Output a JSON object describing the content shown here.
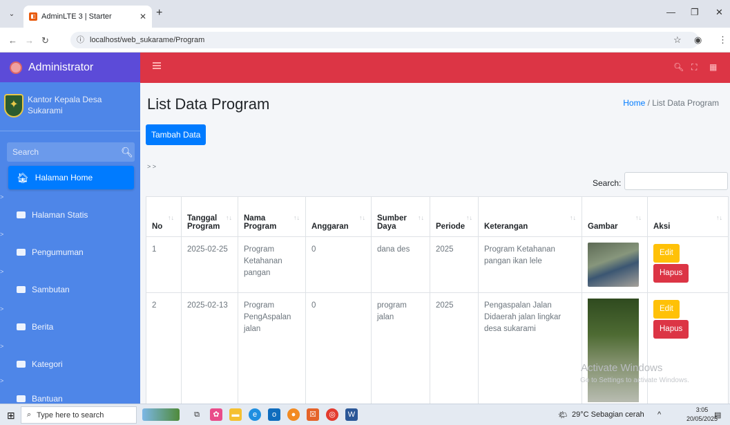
{
  "browser": {
    "tab_title": "AdminLTE 3 | Starter",
    "url": "localhost/web_sukarame/Program"
  },
  "sidebar": {
    "brand": "Administrator",
    "user_name": "Kantor Kepala Desa Sukarami",
    "search_placeholder": "Search",
    "items": [
      {
        "label": "Halaman Home"
      },
      {
        "label": "Halaman Statis"
      },
      {
        "label": "Pengumuman"
      },
      {
        "label": "Sambutan"
      },
      {
        "label": "Berita"
      },
      {
        "label": "Kategori"
      },
      {
        "label": "Bantuan"
      }
    ]
  },
  "page": {
    "title": "List Data Program",
    "breadcrumb_home": "Home",
    "breadcrumb_sep": "/",
    "breadcrumb_current": "List Data Program",
    "add_button": "Tambah Data",
    "nav_marks": "> >",
    "search_label": "Search:"
  },
  "table": {
    "headers": [
      "No",
      "Tanggal Program",
      "Nama Program",
      "Anggaran",
      "Sumber Daya",
      "Periode",
      "Keterangan",
      "Gambar",
      "Aksi"
    ],
    "rows": [
      {
        "no": "1",
        "tanggal": "2025-02-25",
        "nama": "Program Ketahanan pangan",
        "anggaran": "0",
        "sumber": "dana des",
        "periode": "2025",
        "keterangan": "Program Ketahanan pangan ikan lele",
        "edit": "Edit",
        "hapus": "Hapus"
      },
      {
        "no": "2",
        "tanggal": "2025-02-13",
        "nama": "Program PengAspalan jalan",
        "anggaran": "0",
        "sumber": "program jalan",
        "periode": "2025",
        "keterangan": "Pengaspalan Jalan Didaerah jalan lingkar desa sukarami",
        "edit": "Edit",
        "hapus": "Hapus"
      }
    ]
  },
  "watermark": {
    "line1": "Activate Windows",
    "line2": "Go to Settings to activate Windows."
  },
  "taskbar": {
    "search_placeholder": "Type here to search",
    "weather": "29°C  Sebagian cerah",
    "time": "3:05",
    "date": "20/05/2025"
  }
}
